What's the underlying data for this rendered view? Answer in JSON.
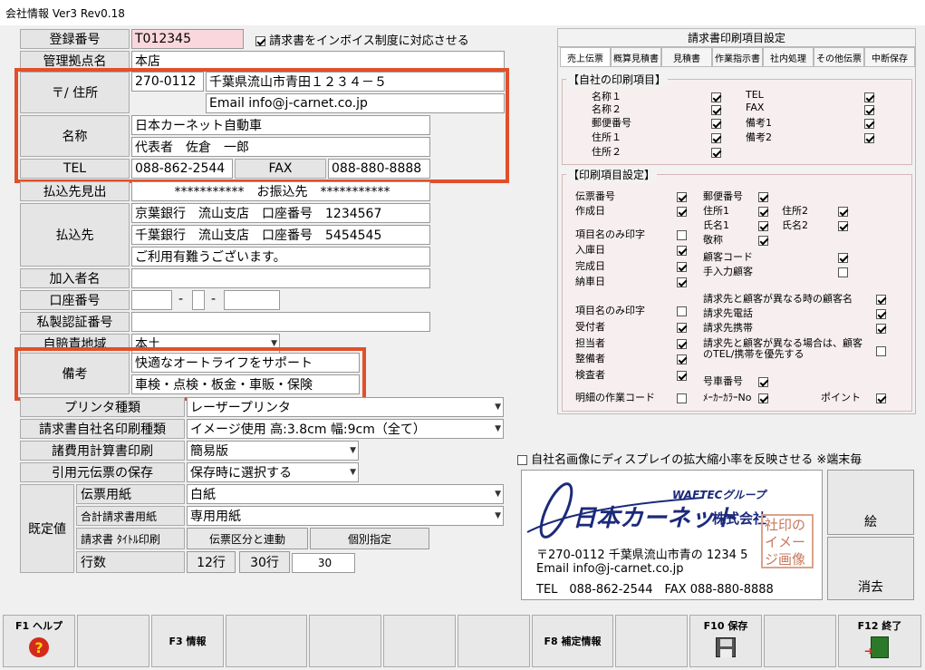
{
  "window": {
    "title": "会社情報 Ver3 Rev0.18"
  },
  "form": {
    "reg_no_label": "登録番号",
    "reg_no": "T012345",
    "invoice_label": "請求書をインボイス制度に対応させる",
    "base_label": "管理拠点名",
    "base": "本店",
    "addr_label": "〒/ 住所",
    "postal": "270-0112",
    "address": "千葉県流山市青田１２３４－５",
    "email": "Email info@j-carnet.co.jp",
    "name_label": "名称",
    "name1": "日本カーネット自動車",
    "name2": "代表者　佐倉　一郎",
    "tel_label": "TEL",
    "tel": "088-862-2544",
    "fax_label": "FAX",
    "fax": "088-880-8888",
    "payee_label": "払込先見出",
    "payee": "***********　お振込先　***********",
    "pay_label": "払込先",
    "pay1": "京葉銀行　流山支店　口座番号　1234567",
    "pay2": "千葉銀行　流山支店　口座番号　5454545",
    "pay3": "ご利用有難うございます。",
    "member_label": "加入者名",
    "acct_label": "口座番号",
    "acct_sep": "-",
    "cert_label": "私製認証番号",
    "region_label": "自賠責地域",
    "region": "本土",
    "note_label": "備考",
    "note1": "快適なオートライフをサポート",
    "note2": "車検・点検・板金・車販・保険",
    "printer_label": "プリンタ種類",
    "printer": "レーザープリンタ",
    "company_print_label": "請求書自社名印刷種類",
    "company_print": "イメージ使用 高:3.8cm 幅:9cm（全て）",
    "calc_label": "諸費用計算書印刷",
    "calc": "簡易版",
    "save_label": "引用元伝票の保存",
    "save": "保存時に選択する",
    "default_label": "既定値",
    "paper_label": "伝票用紙",
    "paper": "白紙",
    "sum_paper_label": "合計請求書用紙",
    "sum_paper": "専用用紙",
    "title_print_label": "請求書 ﾀｲﾄﾙ印刷",
    "title_link": "伝票区分と連動",
    "title_indiv": "個別指定",
    "lines_label": "行数",
    "lines12": "12行",
    "lines30": "30行",
    "lines": "30"
  },
  "print_panel": {
    "title": "請求書印刷項目設定",
    "tabs": [
      "売上伝票",
      "概算見積書",
      "見積書",
      "作業指示書",
      "社内処理",
      "その他伝票",
      "中断保存"
    ],
    "own_title": "【自社の印刷項目】",
    "own_items": [
      "名称１",
      "名称２",
      "郵便番号",
      "住所１",
      "住所２",
      "TEL",
      "FAX",
      "備考1",
      "備考2"
    ],
    "set_title": "【印刷項目設定】",
    "set_items": [
      "伝票番号",
      "作成日",
      "項目名のみ印字",
      "入庫日",
      "完成日",
      "納車日",
      "項目名のみ印字",
      "受付者",
      "担当者",
      "整備者",
      "検査者",
      "明細の作業コード",
      "郵便番号",
      "住所1",
      "住所2",
      "氏名1",
      "氏名2",
      "敬称",
      "顧客コード",
      "手入力顧客",
      "請求先と顧客が異なる時の顧客名",
      "請求先電話",
      "請求先携帯",
      "請求先と顧客が異なる場合は、顧客のTEL/携帯を優先する",
      "号車番号",
      "ﾒｰｶｰｶﾗｰNo",
      "ポイント"
    ]
  },
  "image_area": {
    "checkbox": "自社名画像にディスプレイの拡大縮小率を反映させる ※端末毎",
    "brand": "WAFTECグループ",
    "company": "日本カーネット",
    "suffix": "株式会社",
    "stamp": "社印のイメージ画像",
    "line1": "〒270-0112 千葉県流山市青の 1234 5",
    "line2": "Email info@j-carnet.co.jp",
    "line3": "TEL　088-862-2544　FAX 088-880-8888",
    "btn_pic": "絵",
    "btn_del": "消去"
  },
  "fkeys": {
    "f1": "F1 ヘルプ",
    "f3": "F3 情報",
    "f8": "F8 補定情報",
    "f10": "F10 保存",
    "f12": "F12 終了"
  }
}
